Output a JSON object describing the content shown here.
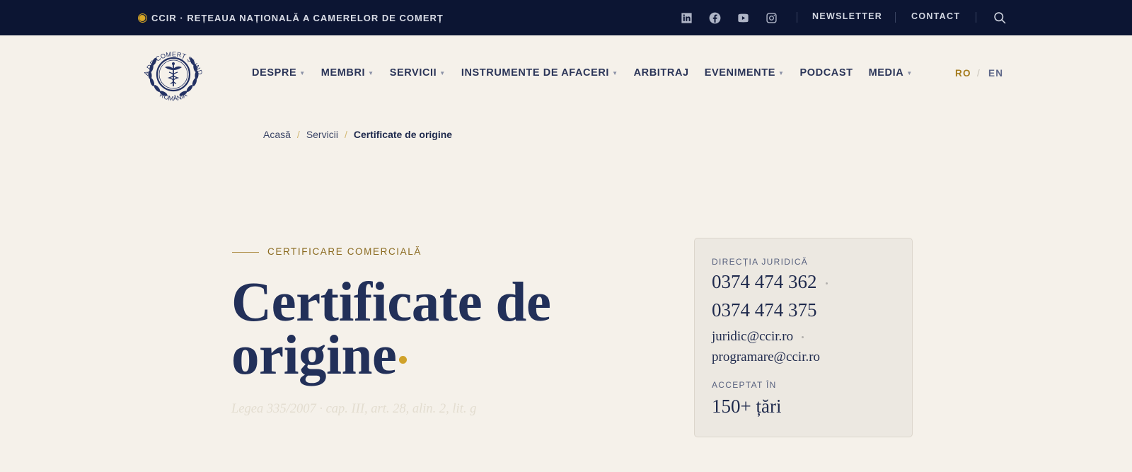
{
  "topbar": {
    "brand": "CCIR · REȚEAUA NAȚIONALĂ A CAMERELOR DE COMERȚ",
    "social": [
      "linkedin-icon",
      "facebook-icon",
      "youtube-icon",
      "instagram-icon"
    ],
    "links": [
      "NEWSLETTER",
      "CONTACT"
    ]
  },
  "logo": {
    "text_top": "CAMERA DE COMERȚ ȘI INDUSTRIE",
    "text_bottom": "ROMÂNIA"
  },
  "nav": {
    "items": [
      {
        "label": "DESPRE",
        "dropdown": true
      },
      {
        "label": "MEMBRI",
        "dropdown": true
      },
      {
        "label": "SERVICII",
        "dropdown": true
      },
      {
        "label": "INSTRUMENTE DE AFACERI",
        "dropdown": true
      },
      {
        "label": "ARBITRAJ",
        "dropdown": false
      },
      {
        "label": "EVENIMENTE",
        "dropdown": true
      },
      {
        "label": "PODCAST",
        "dropdown": false
      },
      {
        "label": "MEDIA",
        "dropdown": true
      }
    ],
    "caret": "▼"
  },
  "lang": {
    "ro": "RO",
    "sep": "/",
    "en": "EN"
  },
  "breadcrumb": {
    "items": [
      "Acasă",
      "Servicii",
      "Certificate de origine"
    ],
    "sep": "/"
  },
  "hero": {
    "eyebrow": "CERTIFICARE COMERCIALĂ",
    "title_line1": "Certificate de",
    "title_line2": "origine",
    "law": "Legea 335/2007 · cap. III, art. 28, alin. 2, lit. g"
  },
  "card": {
    "dept_label": "DIRECȚIA JURIDICĂ",
    "phone1": "0374 474 362",
    "phone2": "0374 474 375",
    "email1": "juridic@ccir.ro",
    "email2": "programare@ccir.ro",
    "accepted_label": "ACCEPTAT ÎN",
    "accepted_value": "150+ țări"
  },
  "colors": {
    "topbar_bg": "#0c1533",
    "page_bg": "#f5f1ea",
    "navy": "#1f2a4d",
    "gold": "#d0a22a"
  }
}
